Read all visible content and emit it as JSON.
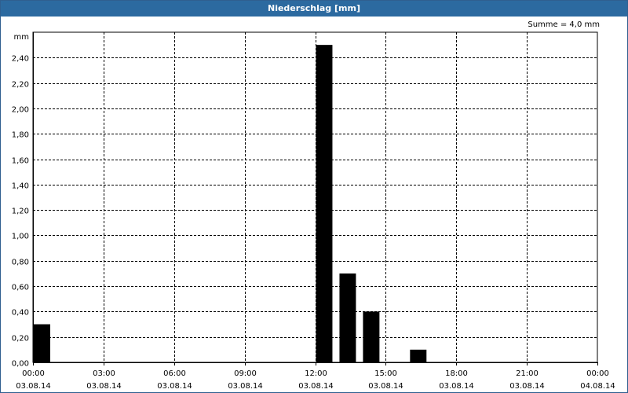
{
  "window": {
    "title": "Niederschlag [mm]"
  },
  "summary": "Summe = 4,0 mm",
  "chart_data": {
    "type": "bar",
    "title": "Niederschlag [mm]",
    "ylabel": "mm",
    "xlabel": "",
    "ylim": [
      0,
      2.6
    ],
    "grid": true,
    "y_ticks": [
      "0,00",
      "0,20",
      "0,40",
      "0,60",
      "0,80",
      "1,00",
      "1,20",
      "1,40",
      "1,60",
      "1,80",
      "2,00",
      "2,20",
      "2,40"
    ],
    "x_ticks": [
      {
        "time": "00:00",
        "date": "03.08.14"
      },
      {
        "time": "03:00",
        "date": "03.08.14"
      },
      {
        "time": "06:00",
        "date": "03.08.14"
      },
      {
        "time": "09:00",
        "date": "03.08.14"
      },
      {
        "time": "12:00",
        "date": "03.08.14"
      },
      {
        "time": "15:00",
        "date": "03.08.14"
      },
      {
        "time": "18:00",
        "date": "03.08.14"
      },
      {
        "time": "21:00",
        "date": "03.08.14"
      },
      {
        "time": "00:00",
        "date": "04.08.14"
      }
    ],
    "bars": [
      {
        "start": "03.08.14 00:00",
        "value": 0.3
      },
      {
        "start": "03.08.14 12:00",
        "value": 2.5
      },
      {
        "start": "03.08.14 13:00",
        "value": 0.7
      },
      {
        "start": "03.08.14 14:00",
        "value": 0.4
      },
      {
        "start": "03.08.14 16:00",
        "value": 0.1
      }
    ],
    "total": 4.0
  },
  "colors": {
    "titlebar": "#2c6aa0",
    "bar": "#000000",
    "grid": "#000000"
  }
}
